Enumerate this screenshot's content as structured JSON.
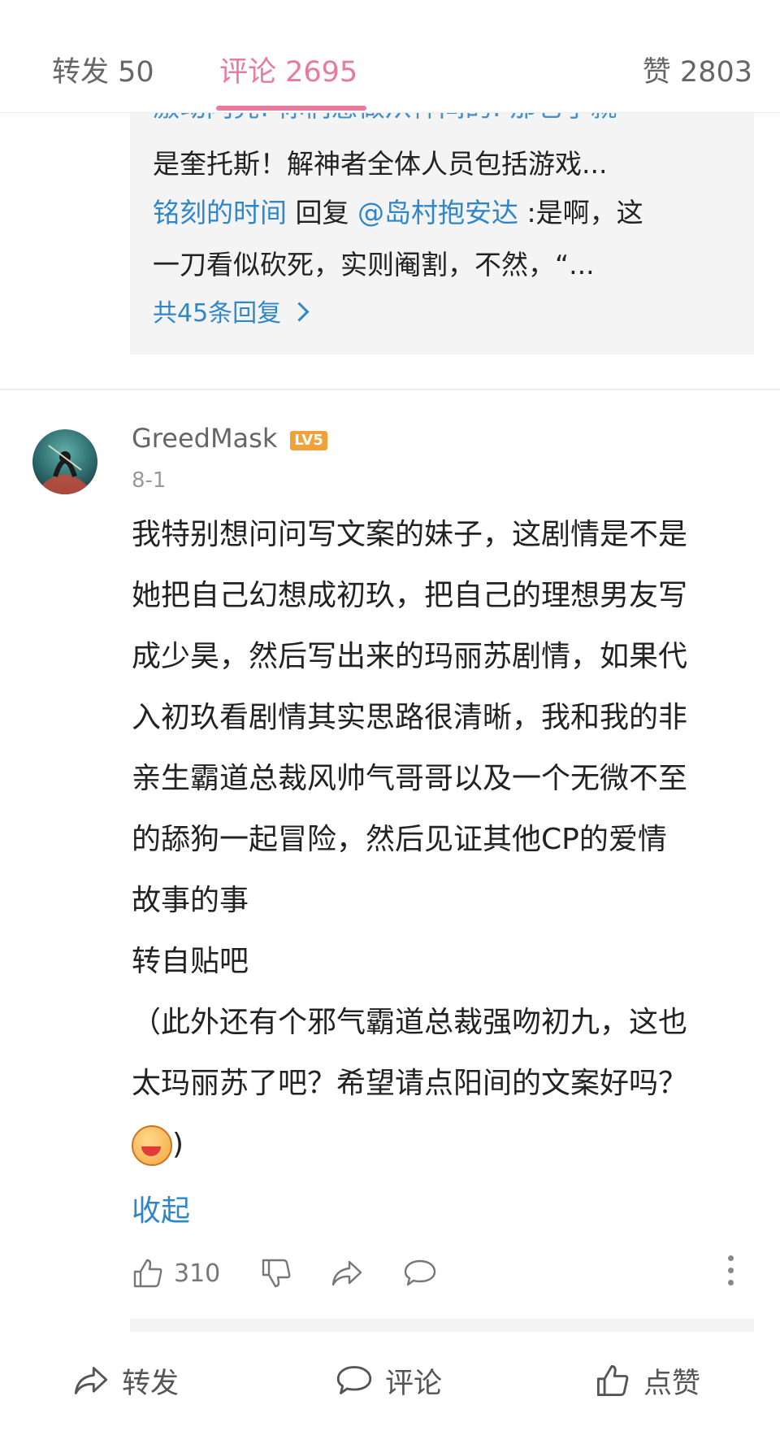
{
  "tabs": {
    "repost": "转发 50",
    "comments": "评论 2695",
    "likes": "赞 2803"
  },
  "reply_preview": {
    "cut_line": "激动闪亮: 你们感做从神间的: 那它了就",
    "line1": "是奎托斯！解神者全体人员包括游戏...",
    "reply_user": "铭刻的时间",
    "reply_word": " 回复 ",
    "reply_target": "@岛村抱安达",
    "reply_text_1": " :是啊，这",
    "reply_text_2": "一刀看似砍死，实则阉割，不然，“...",
    "total_replies": "共45条回复"
  },
  "comment": {
    "username": "GreedMask",
    "level": "LV5",
    "date": "8-1",
    "lines": [
      "我特别想问问写文案的妹子，这剧情是不是",
      "她把自己幻想成初玖，把自己的理想男友写",
      "成少昊，然后写出来的玛丽苏剧情，如果代",
      "入初玖看剧情其实思路很清晰，我和我的非",
      "亲生霸道总裁风帅气哥哥以及一个无微不至",
      "的舔狗一起冒险，然后见证其他CP的爱情",
      "故事的事",
      "转自贴吧",
      "（此外还有个邪气霸道总裁强吻初九，这也",
      "太玛丽苏了吧？希望请点阳间的文案好吗？"
    ],
    "tail": ")",
    "collapse": "收起",
    "like_count": "310"
  },
  "bottom_bar": {
    "repost": "转发",
    "comment": "评论",
    "like": "点赞"
  },
  "colors": {
    "accent": "#e8799f",
    "link": "#2f86c9",
    "level_badge": "#f0a13a"
  },
  "icons": [
    "thumbs-up-icon",
    "thumbs-down-icon",
    "share-icon",
    "comment-bubble-icon",
    "more-vertical-icon",
    "avatar-image"
  ]
}
